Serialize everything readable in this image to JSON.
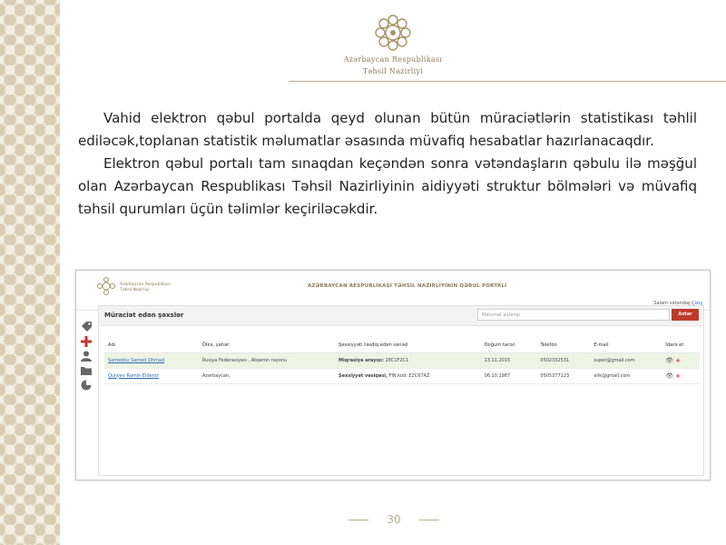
{
  "header": {
    "ministry_line1": "Azərbaycan Respublikası",
    "ministry_line2": "Təhsil Nazirliyi"
  },
  "body": {
    "paragraph1": "Vahid elektron qəbul portalda qeyd olunan bütün müraciətlərin statistikası təhlil ediləcək,toplanan statistik məlumatlar əsasında müvafiq hesabatlar hazırlanacaqdır.",
    "paragraph2": "Elektron qəbul portalı tam sınaqdan keçəndən sonra vətəndaşların qəbulu ilə məşğul olan Azərbaycan Respublikası Təhsil Nazirliyinin aidiyyəti struktur bölmələri və müvafiq təhsil qurumları üçün təlimlər keçiriləcəkdir."
  },
  "portal": {
    "org_line1": "Azərbaycan Respublikası",
    "org_line2": "Təhsil Nazirliyi",
    "title": "AZƏRBAYCAN RESPUBLİKASI TƏHSİL NAZİRLİYİNİN QƏBUL PORTALI",
    "user_greeting": "Salam vətəndaş",
    "logout_label": "Çıxış",
    "section_title": "Müraciət edən şəxslər",
    "search_placeholder": "Məlumat axtarışı",
    "search_button": "Axtar",
    "columns": [
      "Adı",
      "Ölkə, şəhər",
      "Şəxsiyyəti təsdiq edən sənəd",
      "Doğum tarixi",
      "Telefon",
      "E-mail",
      "İdarə et"
    ],
    "rows": [
      {
        "name": "Samedov Samed Ohmad",
        "location": "Rusiya Federasiyası , Abşeron rayonu",
        "doc_label": "Miqrasiya arayışı:",
        "doc_value": "2EC1F2C1",
        "dob": "13.11.2015",
        "phone": "0502332531",
        "email": "super@gmail.com"
      },
      {
        "name": "Quliyev Ramin Eldeniz",
        "location": "Azərbaycan,",
        "doc_label": "Şəxsiyyət vəsiqəsi,",
        "doc_value": "FİN kod: E2C67AZ",
        "dob": "06.10.1987",
        "phone": "0505377123",
        "email": "elik@gmail.com"
      }
    ]
  },
  "footer": {
    "page_number": "30"
  },
  "colors": {
    "accent": "#b9ad8e",
    "brand_text": "#8a7a55",
    "danger": "#c0392b",
    "link": "#2a6cb5"
  }
}
